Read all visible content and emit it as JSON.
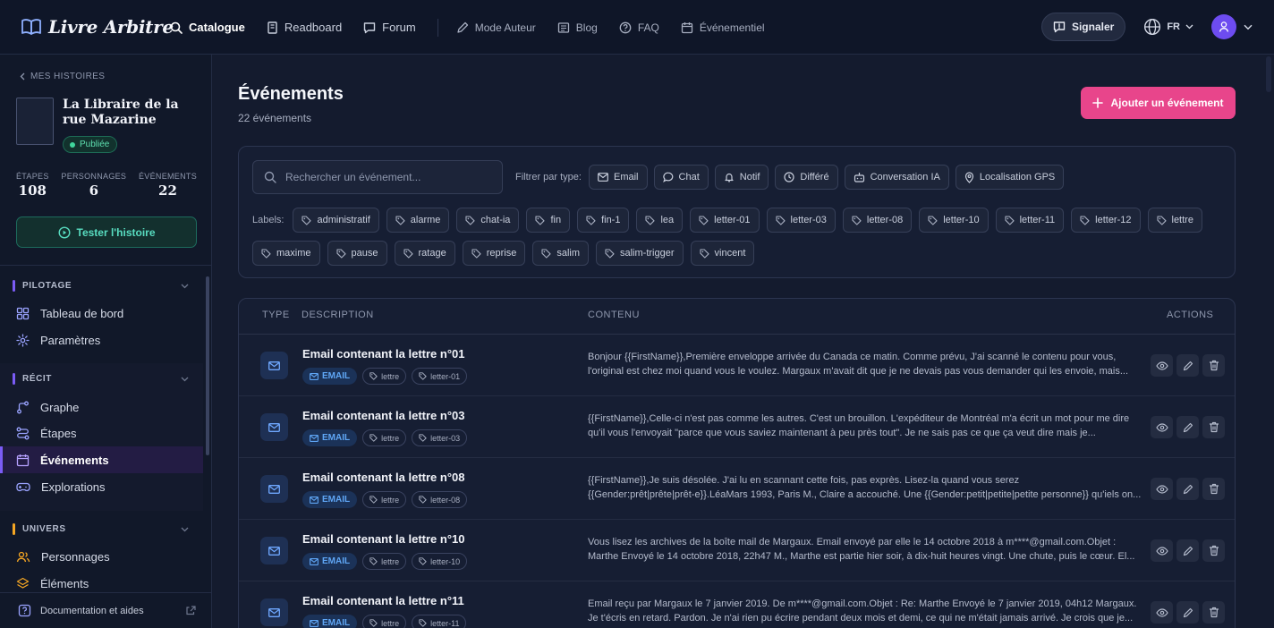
{
  "app": {
    "name": "Livre Arbitre"
  },
  "nav": [
    {
      "label": "Catalogue",
      "icon": "search-icon"
    },
    {
      "label": "Readboard",
      "icon": "book-icon"
    },
    {
      "label": "Forum",
      "icon": "chat-icon"
    },
    {
      "label": "Mode Auteur",
      "icon": "pen-icon"
    },
    {
      "label": "Blog",
      "icon": "newspaper-icon"
    },
    {
      "label": "FAQ",
      "icon": "help-icon"
    },
    {
      "label": "Événementiel",
      "icon": "calendar-icon"
    }
  ],
  "topbar": {
    "signal_label": "Signaler",
    "lang": "FR"
  },
  "sidebar": {
    "back_label": "MES HISTOIRES",
    "story_title": "La Libraire de la rue Mazarine",
    "status": "Publiée",
    "stats": [
      {
        "label": "ÉTAPES",
        "value": "108"
      },
      {
        "label": "PERSONNAGES",
        "value": "6"
      },
      {
        "label": "ÉVÉNEMENTS",
        "value": "22"
      }
    ],
    "test_label": "Tester l'histoire",
    "sections": [
      {
        "title": "PILOTAGE",
        "color": "#7b5cf6",
        "items": [
          {
            "label": "Tableau de bord",
            "icon": "dashboard-icon"
          },
          {
            "label": "Paramètres",
            "icon": "gear-icon"
          }
        ]
      },
      {
        "title": "RÉCIT",
        "color": "#7b5cf6",
        "items": [
          {
            "label": "Graphe",
            "icon": "graph-icon"
          },
          {
            "label": "Étapes",
            "icon": "steps-icon"
          },
          {
            "label": "Événements",
            "icon": "events-icon",
            "active": true
          },
          {
            "label": "Explorations",
            "icon": "gamepad-icon"
          }
        ]
      },
      {
        "title": "UNIVERS",
        "color": "#f5a623",
        "items": [
          {
            "label": "Personnages",
            "icon": "users-icon"
          },
          {
            "label": "Éléments",
            "icon": "elements-icon"
          }
        ]
      }
    ],
    "footer_label": "Documentation et aides"
  },
  "page": {
    "title": "Événements",
    "subtitle": "22 événements",
    "add_label": "Ajouter un événement",
    "search_placeholder": "Rechercher un événement...",
    "filter_label": "Filtrer par type:",
    "types": [
      {
        "label": "Email",
        "icon": "mail-icon"
      },
      {
        "label": "Chat",
        "icon": "chat-icon"
      },
      {
        "label": "Notif",
        "icon": "bell-icon"
      },
      {
        "label": "Différé",
        "icon": "clock-icon"
      },
      {
        "label": "Conversation IA",
        "icon": "robot-icon"
      },
      {
        "label": "Localisation GPS",
        "icon": "pin-icon"
      }
    ],
    "labels_title": "Labels:",
    "labels": [
      "administratif",
      "alarme",
      "chat-ia",
      "fin",
      "fin-1",
      "lea",
      "letter-01",
      "letter-03",
      "letter-08",
      "letter-10",
      "letter-11",
      "letter-12",
      "lettre",
      "maxime",
      "pause",
      "ratage",
      "reprise",
      "salim",
      "salim-trigger",
      "vincent"
    ]
  },
  "table": {
    "headers": {
      "type": "TYPE",
      "description": "DESCRIPTION",
      "content": "CONTENU",
      "actions": "ACTIONS"
    },
    "rows": [
      {
        "title": "Email contenant la lettre n°01",
        "type_tag": "EMAIL",
        "tags": [
          "lettre",
          "letter-01"
        ],
        "content1": "Bonjour {{FirstName}},Première enveloppe arrivée du Canada ce matin. Comme prévu, J'ai scanné le contenu pour vous,",
        "content2": "l'original est chez moi quand vous le voulez. Margaux m'avait dit que je ne devais pas vous demander qui les envoie, mais..."
      },
      {
        "title": "Email contenant la lettre n°03",
        "type_tag": "EMAIL",
        "tags": [
          "lettre",
          "letter-03"
        ],
        "content1": "{{FirstName}},Celle-ci n'est pas comme les autres. C'est un brouillon. L'expéditeur de Montréal m'a écrit un mot pour me dire",
        "content2": "qu'il vous l'envoyait \"parce que vous saviez maintenant à peu près tout\". Je ne sais pas ce que ça veut dire mais je..."
      },
      {
        "title": "Email contenant la lettre n°08",
        "type_tag": "EMAIL",
        "tags": [
          "lettre",
          "letter-08"
        ],
        "content1": "{{FirstName}},Je suis désolée. J'ai lu en scannant cette fois, pas exprès. Lisez-la quand vous serez",
        "content2": "{{Gender:prêt|prête|prêt-e}}.LéaMars 1993, Paris M., Claire a accouché. Une {{Gender:petit|petite|petite personne}} qu'iels on..."
      },
      {
        "title": "Email contenant la lettre n°10",
        "type_tag": "EMAIL",
        "tags": [
          "lettre",
          "letter-10"
        ],
        "content1": "Vous lisez les archives de la boîte mail de Margaux. Email envoyé par elle le 14 octobre 2018 à m****@gmail.com.Objet :",
        "content2": "Marthe Envoyé le 14 octobre 2018, 22h47 M., Marthe est partie hier soir, à dix-huit heures vingt. Une chute, puis le cœur. El..."
      },
      {
        "title": "Email contenant la lettre n°11",
        "type_tag": "EMAIL",
        "tags": [
          "lettre",
          "letter-11"
        ],
        "content1": "Email reçu par Margaux le 7 janvier 2019. De m****@gmail.com.Objet : Re: Marthe Envoyé le 7 janvier 2019, 04h12 Margaux.",
        "content2": "Je t'écris en retard. Pardon. Je n'ai rien pu écrire pendant deux mois et demi, ce qui ne m'était jamais arrivé. Je crois que je..."
      }
    ]
  }
}
